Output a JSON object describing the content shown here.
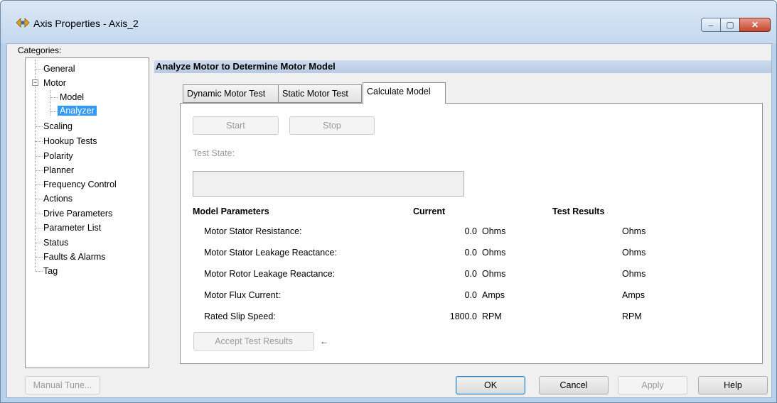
{
  "window": {
    "title": "Axis Properties - Axis_2",
    "controls": {
      "minimize": "–",
      "maximize": "▢",
      "close": "✕"
    }
  },
  "categories": {
    "label": "Categories:",
    "items": [
      {
        "label": "General"
      },
      {
        "label": "Motor",
        "expander": "−"
      },
      {
        "label": "Model"
      },
      {
        "label": "Analyzer",
        "selected": true
      },
      {
        "label": "Scaling"
      },
      {
        "label": "Hookup Tests"
      },
      {
        "label": "Polarity"
      },
      {
        "label": "Planner"
      },
      {
        "label": "Frequency Control"
      },
      {
        "label": "Actions"
      },
      {
        "label": "Drive Parameters"
      },
      {
        "label": "Parameter List"
      },
      {
        "label": "Status"
      },
      {
        "label": "Faults & Alarms"
      },
      {
        "label": "Tag"
      }
    ]
  },
  "header": {
    "title": "Analyze Motor to Determine Motor Model"
  },
  "tabs": [
    {
      "label": "Dynamic Motor Test"
    },
    {
      "label": "Static Motor Test"
    },
    {
      "label": "Calculate Model",
      "active": true
    }
  ],
  "panel": {
    "start_label": "Start",
    "stop_label": "Stop",
    "test_state_label": "Test State:",
    "test_state_value": "",
    "columns": {
      "model_parameters": "Model Parameters",
      "current": "Current",
      "test_results": "Test Results"
    },
    "rows": [
      {
        "name": "Motor Stator Resistance:",
        "value": "0.0",
        "unit": "Ohms",
        "result_unit": "Ohms"
      },
      {
        "name": "Motor Stator Leakage Reactance:",
        "value": "0.0",
        "unit": "Ohms",
        "result_unit": "Ohms"
      },
      {
        "name": "Motor Rotor Leakage Reactance:",
        "value": "0.0",
        "unit": "Ohms",
        "result_unit": "Ohms"
      },
      {
        "name": "Motor Flux Current:",
        "value": "0.0",
        "unit": "Amps",
        "result_unit": "Amps"
      },
      {
        "name": "Rated Slip Speed:",
        "value": "1800.0",
        "unit": "RPM",
        "result_unit": "RPM"
      }
    ],
    "accept_label": "Accept Test Results",
    "accept_icon": "left-arrow-icon"
  },
  "footer": {
    "manual_tune_label": "Manual Tune...",
    "ok_label": "OK",
    "cancel_label": "Cancel",
    "apply_label": "Apply",
    "help_label": "Help"
  },
  "colors": {
    "selection": "#3399ff",
    "header_bar": "#c4d6ec",
    "title_bar": "#cfe0f3",
    "close_button": "#c4452c"
  }
}
